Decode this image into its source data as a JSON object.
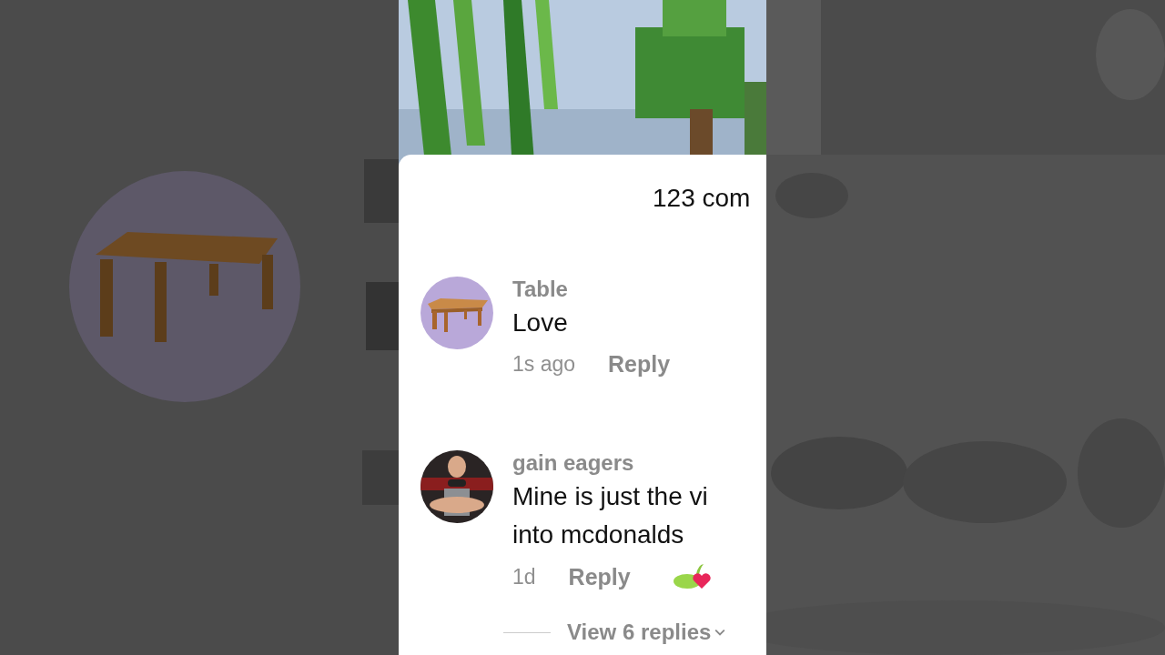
{
  "sheet": {
    "title": "123 com"
  },
  "comments": [
    {
      "author": "Table",
      "lines": [
        "Love"
      ],
      "time": "1s ago",
      "reply": "Reply",
      "sticker": false
    },
    {
      "author": "gain eagers",
      "lines": [
        "Mine is just the vi",
        "into mcdonalds"
      ],
      "time": "1d",
      "reply": "Reply",
      "sticker": true,
      "replies_link": "View 6 replies"
    }
  ]
}
